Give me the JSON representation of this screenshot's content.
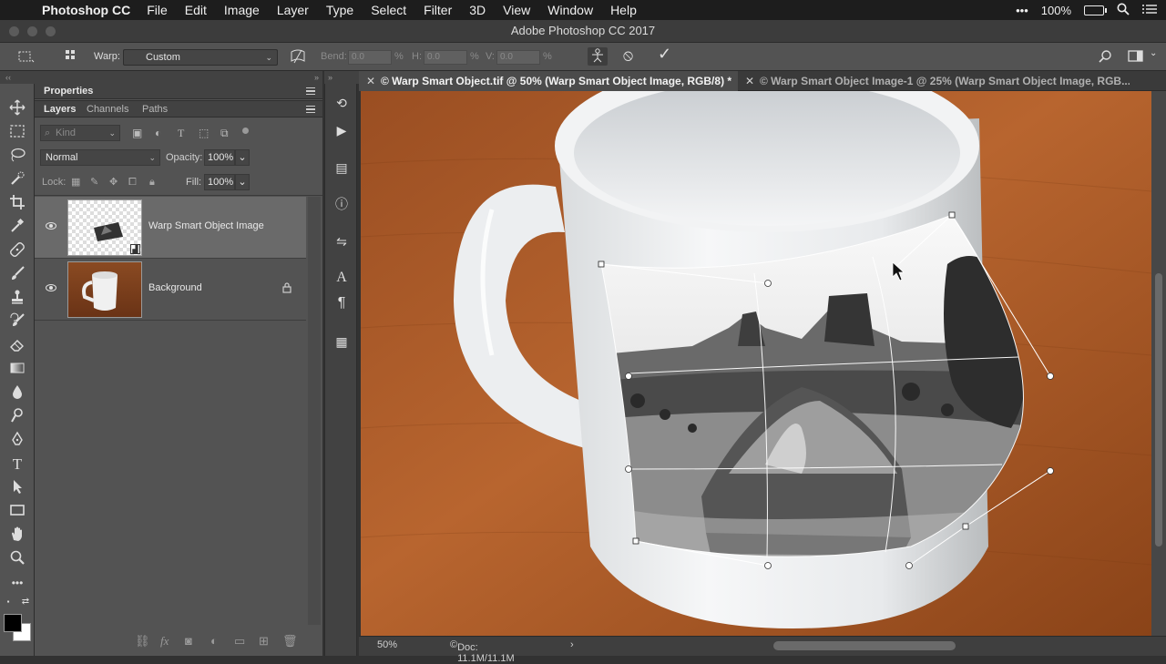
{
  "menubar": {
    "app": "Photoshop CC",
    "items": [
      "File",
      "Edit",
      "Image",
      "Layer",
      "Type",
      "Select",
      "Filter",
      "3D",
      "View",
      "Window",
      "Help"
    ],
    "battery": "100%",
    "dots": "•••"
  },
  "window": {
    "title": "Adobe Photoshop CC 2017"
  },
  "options": {
    "warp_label": "Warp:",
    "warp_value": "Custom",
    "bend_label": "Bend:",
    "bend_value": "0.0",
    "h_label": "H:",
    "h_value": "0.0",
    "v_label": "V:",
    "v_value": "0.0",
    "percent": "%"
  },
  "panels": {
    "properties_tab": "Properties",
    "tabs": [
      "Layers",
      "Channels",
      "Paths"
    ],
    "kind_placeholder": "Kind",
    "blend_mode": "Normal",
    "opacity_label": "Opacity:",
    "opacity_value": "100%",
    "lock_label": "Lock:",
    "fill_label": "Fill:",
    "fill_value": "100%",
    "layers": [
      {
        "name": "Warp Smart Object Image",
        "selected": true,
        "visible": true
      },
      {
        "name": "Background",
        "selected": false,
        "visible": true,
        "locked": true
      }
    ]
  },
  "document": {
    "tabs": [
      {
        "label": "© Warp Smart Object.tif @ 50% (Warp Smart Object Image, RGB/8) *",
        "active": true
      },
      {
        "label": "© Warp Smart Object Image-1 @ 25% (Warp Smart Object Image, RGB...",
        "active": false
      }
    ],
    "zoom": "50%",
    "doc_info": "Doc: 11.1M/11.1M",
    "arrow": "›"
  },
  "icons": {
    "close": "✕",
    "chevron": "⌄",
    "check": "✓",
    "cancel": "⦸"
  }
}
